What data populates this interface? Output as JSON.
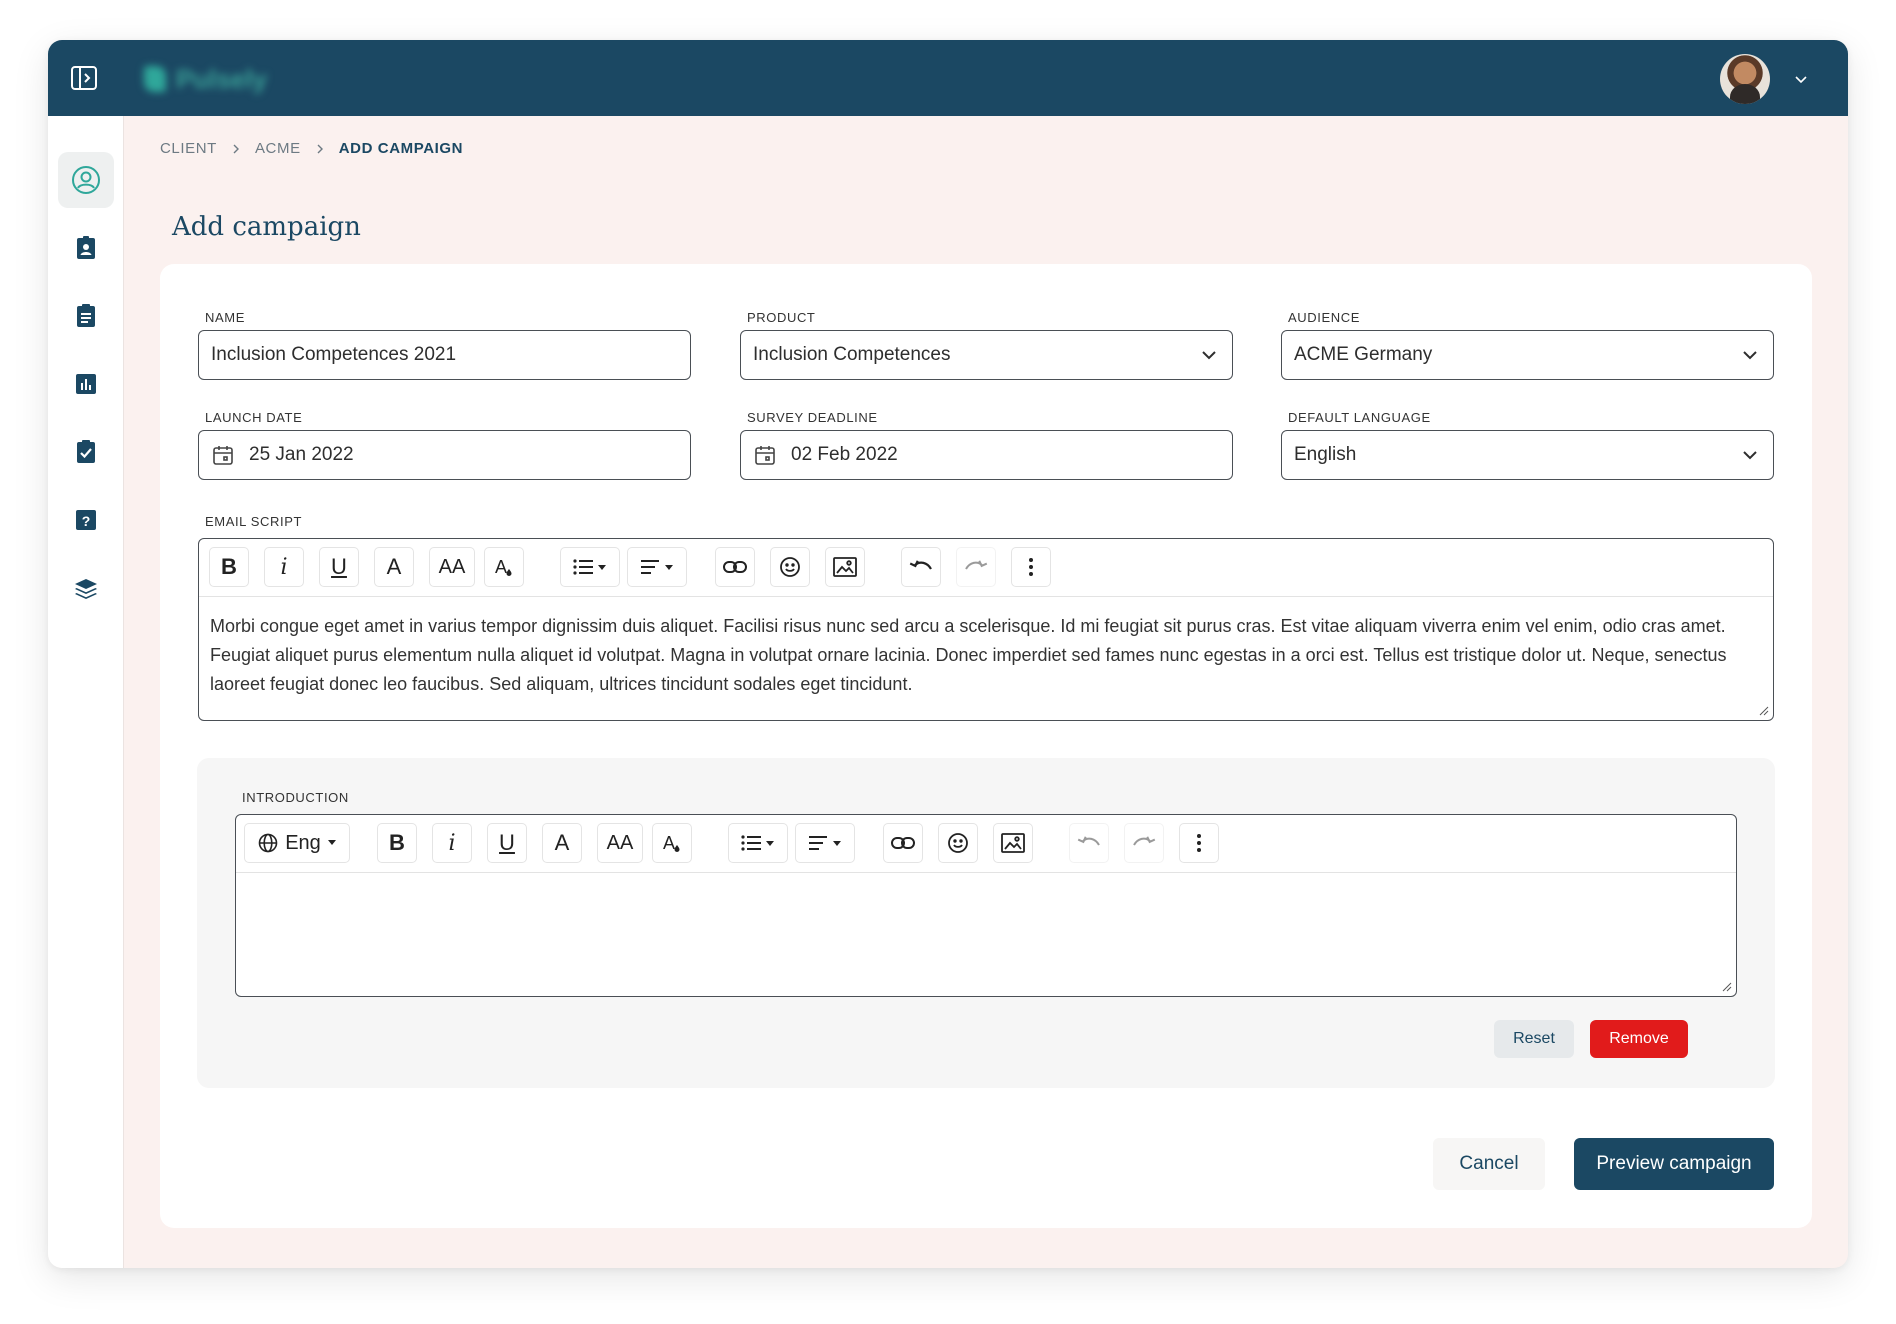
{
  "app": {
    "logo_text": "Pulsely"
  },
  "breadcrumb": [
    "CLIENT",
    "ACME",
    "ADD CAMPAIGN"
  ],
  "page_title": "Add campaign",
  "fields": {
    "name": {
      "label": "NAME",
      "value": "Inclusion Competences 2021"
    },
    "product": {
      "label": "PRODUCT",
      "value": "Inclusion Competences"
    },
    "audience": {
      "label": "AUDIENCE",
      "value": "ACME Germany"
    },
    "launch_date": {
      "label": "LAUNCH DATE",
      "value": "25 Jan 2022"
    },
    "survey_deadline": {
      "label": "SURVEY DEADLINE",
      "value": "02 Feb 2022"
    },
    "default_language": {
      "label": "DEFAULT LANGUAGE",
      "value": "English"
    }
  },
  "email_script": {
    "label": "EMAIL SCRIPT",
    "text": "Morbi congue eget amet in varius tempor dignissim duis aliquet. Facilisi risus nunc sed arcu a scelerisque. Id mi feugiat sit purus cras. Est vitae aliquam viverra enim vel enim, odio cras amet. Feugiat aliquet purus elementum nulla aliquet id volutpat. Magna in volutpat ornare lacinia. Donec imperdiet sed fames nunc egestas in a orci est. Tellus est tristique dolor ut. Neque, senectus laoreet feugiat donec leo faucibus. Sed aliquam, ultrices tincidunt sodales eget tincidunt."
  },
  "toolbar": {
    "bold": "B",
    "italic": "i",
    "underline": "U",
    "font_color": "A",
    "font_size": "AA"
  },
  "introduction": {
    "label": "INTRODUCTION",
    "language": "Eng",
    "text": ""
  },
  "buttons": {
    "reset": "Reset",
    "remove": "Remove",
    "cancel": "Cancel",
    "preview": "Preview campaign"
  },
  "colors": {
    "primary": "#1b4863",
    "accent": "#2fa79a",
    "danger": "#e11b1b",
    "background": "#fbf1ef"
  }
}
